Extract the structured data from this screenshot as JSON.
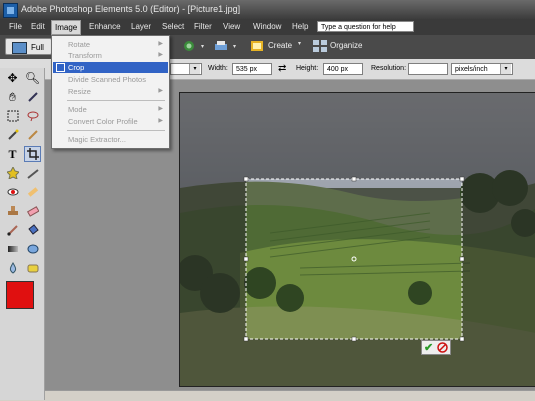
{
  "app": {
    "title": "Adobe Photoshop Elements 5.0 (Editor) - [Picture1.jpg]"
  },
  "menubar": {
    "items": [
      "File",
      "Edit",
      "Image",
      "Enhance",
      "Layer",
      "Select",
      "Filter",
      "View",
      "Window",
      "Help"
    ],
    "help_placeholder": "Type a question for help"
  },
  "toolbar": {
    "full_edit": "Full E",
    "create": "Create",
    "organize": "Organize"
  },
  "options": {
    "width_label": "Width:",
    "width_value": "535 px",
    "height_label": "Height:",
    "height_value": "400 px",
    "resolution_label": "Resolution:",
    "resolution_value": "",
    "unit_value": "pixels/inch"
  },
  "image_menu": {
    "items": [
      {
        "label": "Rotate",
        "submenu": true
      },
      {
        "label": "Transform",
        "submenu": true
      },
      {
        "label": "Crop",
        "highlighted": true
      },
      {
        "label": "Divide Scanned Photos"
      },
      {
        "label": "Resize",
        "submenu": true
      },
      {
        "label": "Mode",
        "submenu": true
      },
      {
        "label": "Convert Color Profile",
        "submenu": true
      },
      {
        "label": "Magic Extractor..."
      }
    ]
  },
  "colors": {
    "foreground": "#e01010",
    "background": "#ffffff",
    "menu_highlight": "#3163c5"
  },
  "icons": [
    "move-icon",
    "zoom-icon",
    "hand-icon",
    "eyedropper-icon",
    "marquee-icon",
    "lasso-icon",
    "magic-wand-icon",
    "selection-brush-icon",
    "type-icon",
    "crop-icon",
    "cookie-cutter-icon",
    "straighten-icon",
    "red-eye-icon",
    "healing-brush-icon",
    "clone-stamp-icon",
    "eraser-icon",
    "brush-icon",
    "paint-bucket-icon",
    "gradient-icon",
    "shape-icon",
    "blur-icon",
    "sponge-icon",
    "commit-icon",
    "cancel-icon"
  ]
}
